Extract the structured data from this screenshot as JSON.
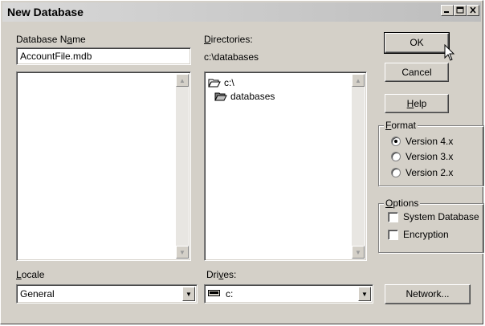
{
  "window": {
    "title": "New Database",
    "controls": {
      "minimize": "▭",
      "maximize": "□",
      "close": "✕"
    }
  },
  "database": {
    "name_label_pre": "Database N",
    "name_label_key": "a",
    "name_label_post": "me",
    "name_value": "AccountFile.mdb",
    "files": []
  },
  "directories": {
    "label_key": "D",
    "label_rest": "irectories:",
    "current_path": "c:\\databases",
    "tree": [
      {
        "label": "c:\\",
        "icon": "open-folder-icon"
      },
      {
        "label": "databases",
        "icon": "open-folder-icon"
      }
    ]
  },
  "locale": {
    "label_key": "L",
    "label_rest": "ocale",
    "value": "General"
  },
  "drives": {
    "label_pre": "Dri",
    "label_key": "v",
    "label_post": "es:",
    "value": "c:",
    "icon": "drive-icon"
  },
  "buttons": {
    "ok": "OK",
    "cancel": "Cancel",
    "help_key": "H",
    "help_rest": "elp",
    "network": "Network..."
  },
  "format": {
    "title_key": "F",
    "title_rest": "ormat",
    "options": [
      {
        "label": "Version 4.x",
        "selected": true
      },
      {
        "label": "Version 3.x",
        "selected": false
      },
      {
        "label": "Version 2.x",
        "selected": false
      }
    ]
  },
  "options": {
    "title_key": "O",
    "title_rest": "ptions",
    "items": [
      {
        "label": "System Database",
        "checked": false
      },
      {
        "label": "Encryption",
        "checked": false
      }
    ]
  }
}
